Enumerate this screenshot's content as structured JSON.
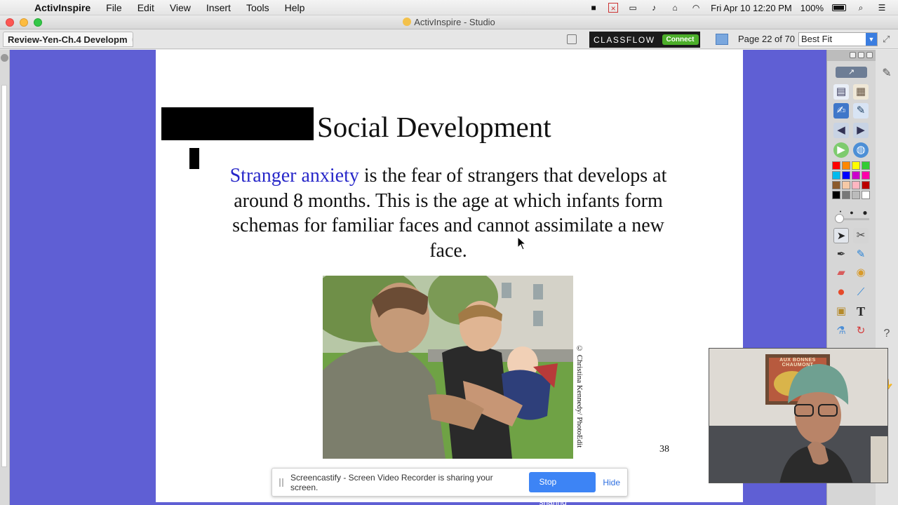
{
  "menubar": {
    "items": [
      "ActivInspire",
      "File",
      "Edit",
      "View",
      "Insert",
      "Tools",
      "Help"
    ],
    "clock": "Fri Apr 10  12:20 PM",
    "battery": "100%"
  },
  "window": {
    "title": "ActivInspire - Studio"
  },
  "tabbar": {
    "doc_tab": "Review-Yen-Ch.4 Developm",
    "classflow_label": "CLASSFLOW",
    "classflow_connect": "Connect",
    "page_indicator": "Page 22 of 70",
    "zoom": "Best Fit"
  },
  "slide": {
    "title": "Social Development",
    "body_term": "Stranger anxiety",
    "body_rest": " is the fear of strangers that develops at around 8 months. This is the age at which infants form schemas for familiar faces and cannot assimilate a new face.",
    "photo_credit": "© Christina Kennedy/ PhotoEdit",
    "page_number": "38"
  },
  "share_notification": {
    "message": "Screencastify - Screen Video Recorder is sharing your screen.",
    "stop_label": "Stop sharing",
    "hide_label": "Hide"
  },
  "webcam": {
    "poster_text": "AUX BONNES CHAUMONT"
  },
  "colors": {
    "workspace": "#5f5fd4",
    "accent_term": "#2727c9",
    "stop_button": "#3d84f5"
  },
  "palette": [
    "#ff0000",
    "#ff8800",
    "#ffff00",
    "#33cc33",
    "#00bbee",
    "#0000ff",
    "#cc00cc",
    "#ff00aa",
    "#8b5a2b",
    "#f5c9a6",
    "#ffb6c1",
    "#bb0000",
    "#000000",
    "#777777",
    "#bbbbbb",
    "#ffffff"
  ]
}
